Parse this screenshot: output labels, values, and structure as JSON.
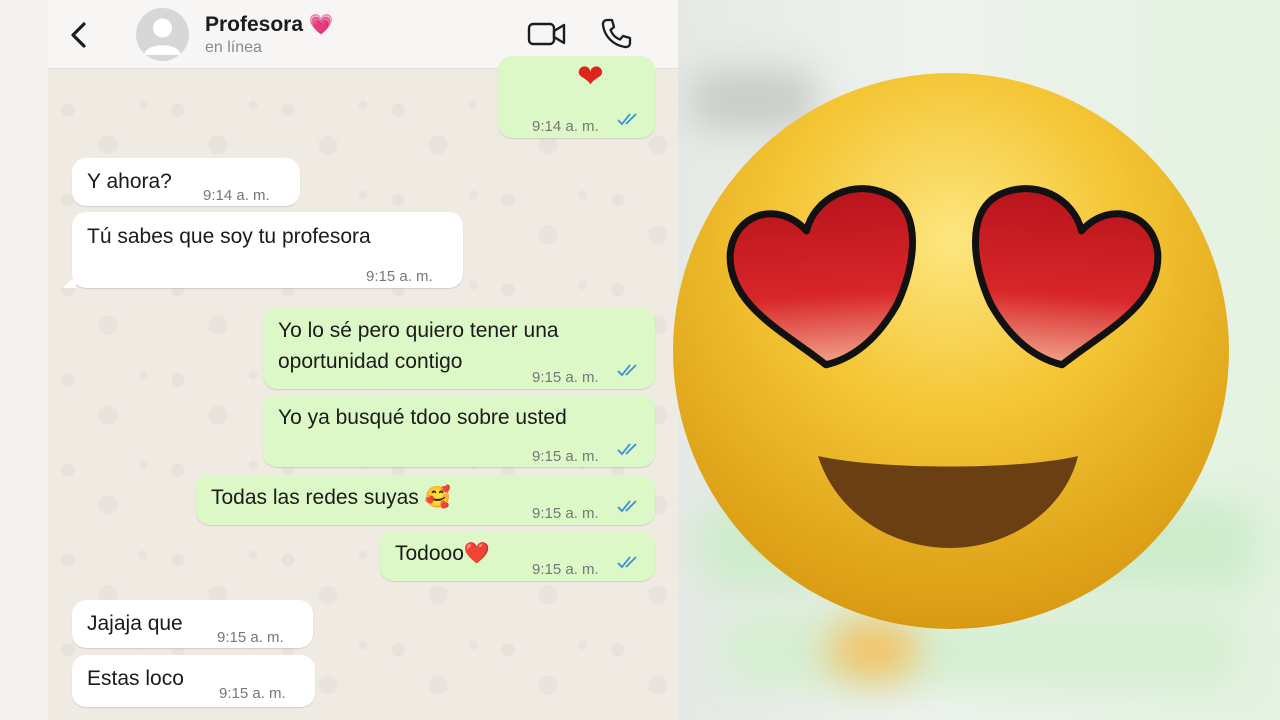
{
  "header": {
    "back_icon": "chevron-left-icon",
    "contact_name": "Profesora",
    "contact_emoji": "💗",
    "status": "en línea",
    "video_icon": "video-camera-icon",
    "call_icon": "phone-icon"
  },
  "messages": [
    {
      "dir": "out",
      "text": "",
      "time": "9:14 a. m.",
      "read": true,
      "partial_emoji": "❤"
    },
    {
      "dir": "in",
      "text": "Y ahora?",
      "time": "9:14 a. m."
    },
    {
      "dir": "in",
      "text": "Tú sabes que soy tu profesora",
      "time": "9:15 a. m."
    },
    {
      "dir": "out",
      "text_line1": "Yo lo sé pero quiero tener una",
      "text_line2": "oportunidad contigo",
      "time": "9:15 a. m.",
      "read": true
    },
    {
      "dir": "out",
      "text": "Yo ya busqué tdoo sobre usted",
      "time": "9:15 a. m.",
      "read": true
    },
    {
      "dir": "out",
      "text": "Todas las redes suyas 🥰",
      "time": "9:15 a. m.",
      "read": true
    },
    {
      "dir": "out",
      "text": "Todooo❤️",
      "time": "9:15 a. m.",
      "read": true
    },
    {
      "dir": "in",
      "text": "Jajaja que",
      "time": "9:15 a. m."
    },
    {
      "dir": "in",
      "text": "Estas loco",
      "time": "9:15 a. m."
    }
  ],
  "overlay": {
    "emoji_icon": "heart-eyes-emoji-icon"
  },
  "colors": {
    "incoming_bubble": "#ffffff",
    "outgoing_bubble": "#dbf8c6",
    "read_ticks": "#3a8fd8",
    "emoji_yellow": "#f2c232",
    "heart_red": "#d8262a"
  }
}
